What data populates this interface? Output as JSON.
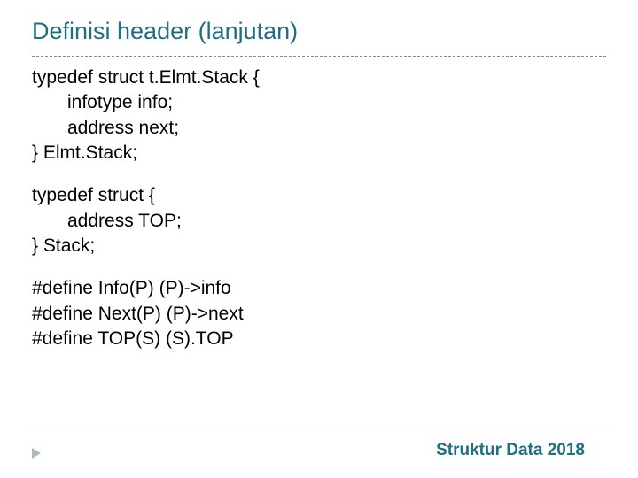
{
  "title": "Definisi header (lanjutan)",
  "block1": {
    "l1": "typedef struct t.Elmt.Stack {",
    "l2": "infotype info;",
    "l3": "address next;",
    "l4": "} Elmt.Stack;"
  },
  "block2": {
    "l1": "typedef struct {",
    "l2": "address TOP;",
    "l3": "} Stack;"
  },
  "block3": {
    "l1": "#define Info(P) (P)->info",
    "l2": "#define Next(P) (P)->next",
    "l3": "#define TOP(S) (S).TOP"
  },
  "footer": "Struktur Data 2018"
}
